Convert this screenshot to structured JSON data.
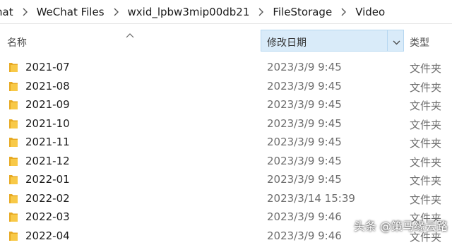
{
  "breadcrumb": [
    "hat",
    "WeChat Files",
    "wxid_lpbw3mip00db21",
    "FileStorage",
    "Video"
  ],
  "columns": {
    "name": "名称",
    "date_modified": "修改日期",
    "type": "类型"
  },
  "rows": [
    {
      "name": "2021-07",
      "date": "2023/3/9 9:45",
      "type": "文件夹"
    },
    {
      "name": "2021-08",
      "date": "2023/3/9 9:45",
      "type": "文件夹"
    },
    {
      "name": "2021-09",
      "date": "2023/3/9 9:45",
      "type": "文件夹"
    },
    {
      "name": "2021-10",
      "date": "2023/3/9 9:45",
      "type": "文件夹"
    },
    {
      "name": "2021-11",
      "date": "2023/3/9 9:45",
      "type": "文件夹"
    },
    {
      "name": "2021-12",
      "date": "2023/3/9 9:45",
      "type": "文件夹"
    },
    {
      "name": "2022-01",
      "date": "2023/3/9 9:45",
      "type": "文件夹"
    },
    {
      "name": "2022-02",
      "date": "2023/3/14 15:39",
      "type": "文件夹"
    },
    {
      "name": "2022-03",
      "date": "2023/3/9 9:46",
      "type": "文件夹"
    },
    {
      "name": "2022-04",
      "date": "2023/3/9 9:46",
      "type": "文件夹"
    }
  ],
  "watermark": "头条 @策马缘云路",
  "colors": {
    "folder": "#f8c948",
    "folder_back": "#e7a921",
    "header_selected": "#d9ebf9"
  }
}
